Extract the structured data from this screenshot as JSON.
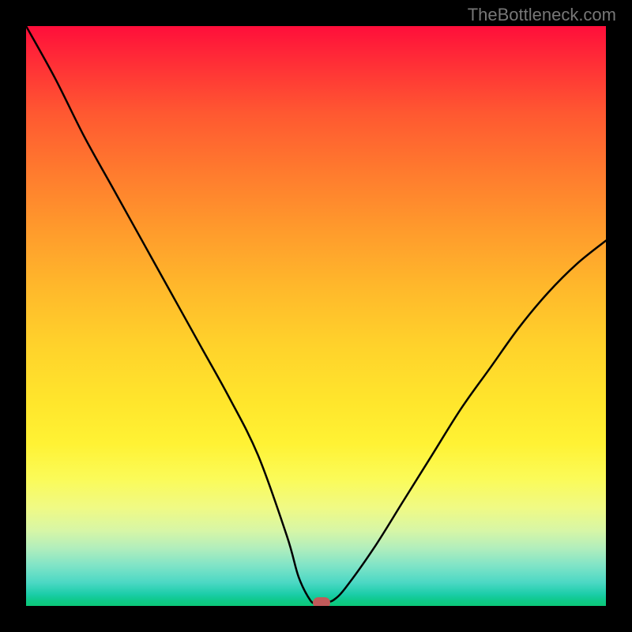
{
  "watermark": "TheBottleneck.com",
  "chart_data": {
    "type": "line",
    "title": "",
    "xlabel": "",
    "ylabel": "",
    "xlim": [
      0,
      100
    ],
    "ylim": [
      0,
      100
    ],
    "x": [
      0,
      5,
      10,
      15,
      20,
      25,
      30,
      35,
      40,
      45,
      47,
      49,
      50,
      51,
      52,
      53,
      55,
      60,
      65,
      70,
      75,
      80,
      85,
      90,
      95,
      100
    ],
    "y": [
      100,
      91,
      81,
      72,
      63,
      54,
      45,
      36,
      26,
      12,
      5,
      1,
      0.5,
      0.5,
      0.7,
      1,
      3,
      10,
      18,
      26,
      34,
      41,
      48,
      54,
      59,
      63
    ],
    "marker": {
      "x": 51,
      "y": 0.5
    },
    "gradient_stops": [
      {
        "pos": 0,
        "color": "#ff0e3a"
      },
      {
        "pos": 50,
        "color": "#ffcc2b"
      },
      {
        "pos": 80,
        "color": "#fbfb58"
      },
      {
        "pos": 100,
        "color": "#0bc878"
      }
    ]
  }
}
